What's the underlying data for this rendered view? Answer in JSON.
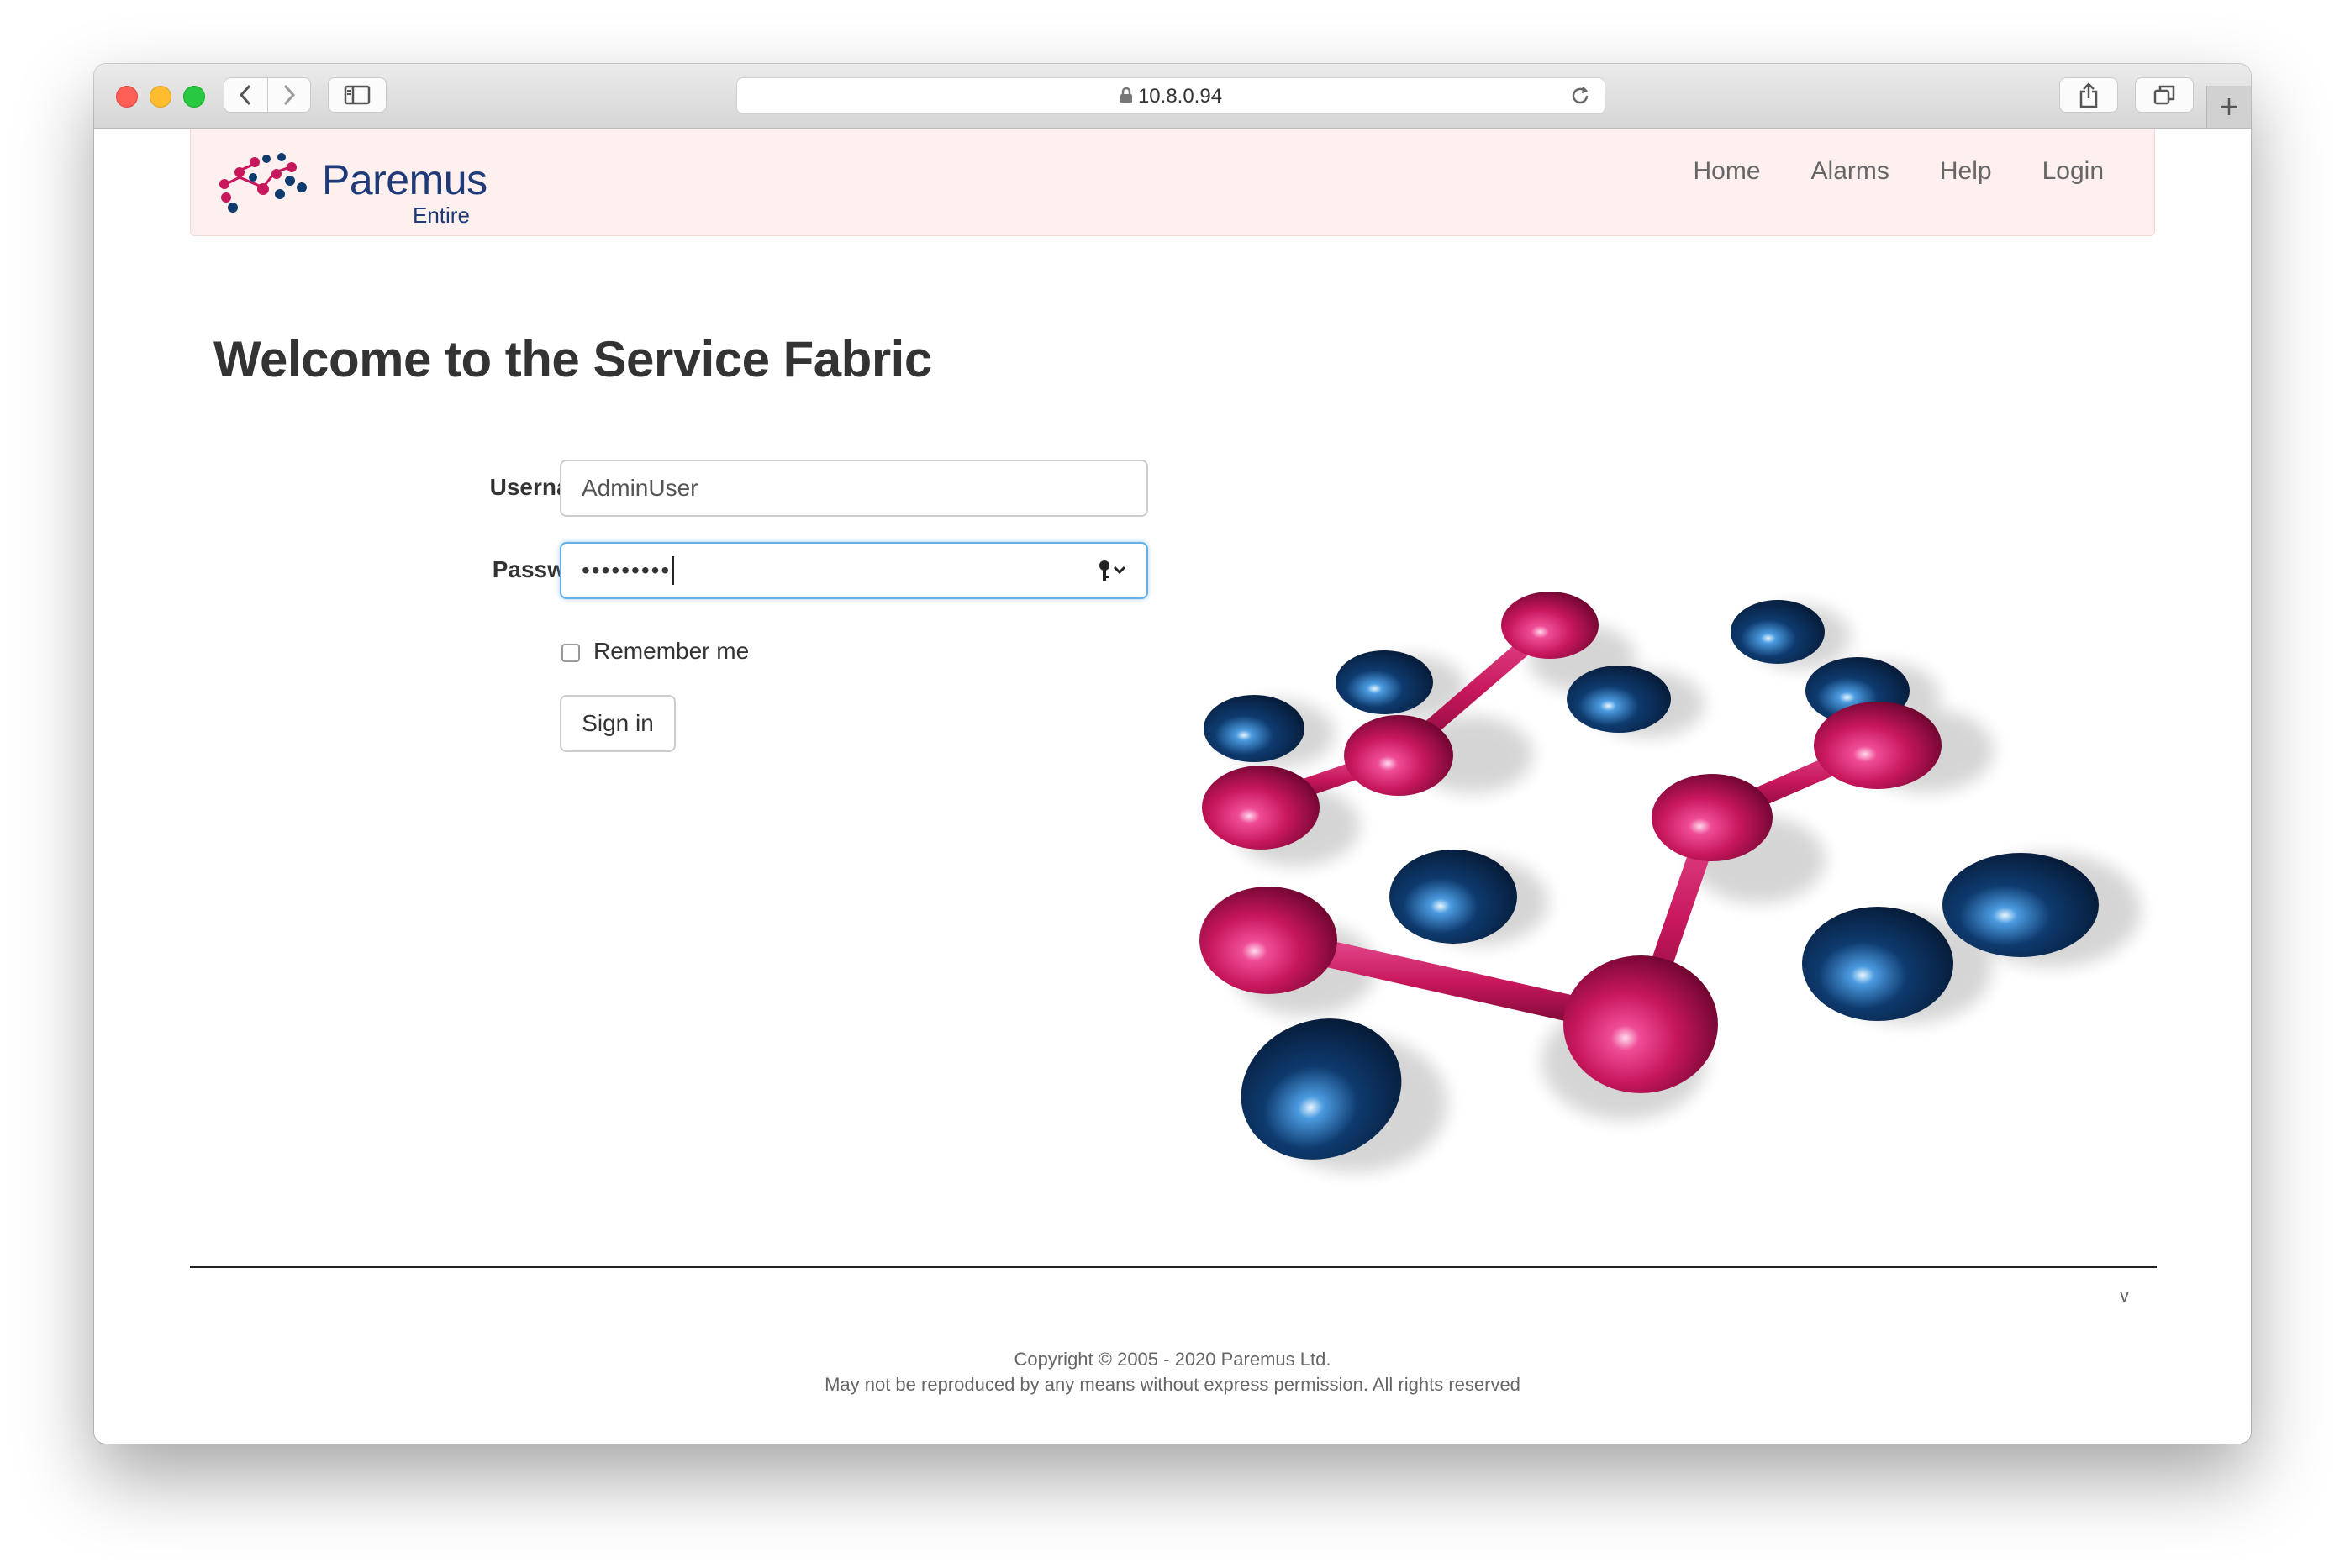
{
  "browser": {
    "address": "10.8.0.94"
  },
  "navbar": {
    "brand": "Paremus",
    "brand_sub": "Entire",
    "links": [
      "Home",
      "Alarms",
      "Help",
      "Login"
    ]
  },
  "main": {
    "heading": "Welcome to the Service Fabric",
    "username_label": "Username",
    "username_value": "AdminUser",
    "password_label": "Password",
    "password_masked": "•••••••••",
    "remember_label": "Remember me",
    "signin_label": "Sign in"
  },
  "footer": {
    "version": "v",
    "copyright": "Copyright © 2005 - 2020 Paremus Ltd.",
    "notice": "May not be reproduced by any means without express permission. All rights reserved"
  },
  "colors": {
    "navbar_bg": "#fdf0ef",
    "brand": "#1f3a78",
    "magenta_node": "#c8175d",
    "blue_node": "#0e3a6e"
  }
}
